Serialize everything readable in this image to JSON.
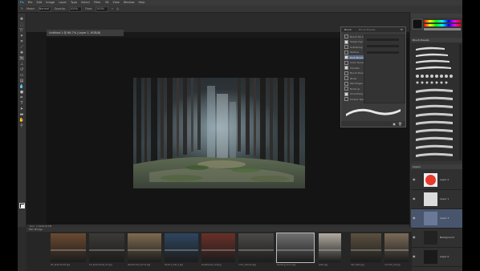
{
  "menubar": {
    "items": [
      "Ps",
      "File",
      "Edit",
      "Image",
      "Layer",
      "Type",
      "Select",
      "Filter",
      "3D",
      "View",
      "Window",
      "Help"
    ]
  },
  "optionsbar": {
    "mode_label": "Mode:",
    "mode_value": "Normal",
    "opacity_label": "Opacity:",
    "opacity_value": "100%",
    "flow_label": "Flow:",
    "flow_value": "100%"
  },
  "document": {
    "tab_title": "Untitled-1 @ 66.7% (Layer 1, RGB/8)",
    "status": "Doc: 7.91M/18.5M"
  },
  "brush_panel": {
    "tabs": [
      "Brush",
      "Brush Presets"
    ],
    "options": [
      {
        "label": "Brush Tip Shape",
        "checked": false,
        "selected": false
      },
      {
        "label": "Shape Dynamics",
        "checked": true,
        "selected": false
      },
      {
        "label": "Scattering",
        "checked": false,
        "selected": false
      },
      {
        "label": "Texture",
        "checked": false,
        "selected": false
      },
      {
        "label": "Dual Brush",
        "checked": true,
        "selected": true
      },
      {
        "label": "Color Dynamics",
        "checked": false,
        "selected": false
      },
      {
        "label": "Transfer",
        "checked": true,
        "selected": false
      },
      {
        "label": "Brush Pose",
        "checked": false,
        "selected": false
      },
      {
        "label": "Noise",
        "checked": false,
        "selected": false
      },
      {
        "label": "Wet Edges",
        "checked": false,
        "selected": false
      },
      {
        "label": "Build-up",
        "checked": false,
        "selected": false
      },
      {
        "label": "Smoothing",
        "checked": true,
        "selected": false
      },
      {
        "label": "Protect Texture",
        "checked": false,
        "selected": false
      }
    ]
  },
  "right_dock": {
    "swatches_title": "Color",
    "brush_presets_title": "Brush Presets",
    "layers_title": "Layers",
    "layers": [
      {
        "name": "Layer 2",
        "thumb_color": "#e83a2c",
        "selected": false
      },
      {
        "name": "Layer 1",
        "thumb_color": "#dcdcdc",
        "selected": false
      },
      {
        "name": "Layer 3",
        "thumb_color": "#6a7a96",
        "selected": true
      },
      {
        "name": "Background",
        "thumb_color": "#222222",
        "selected": false
      },
      {
        "name": "Layer 0",
        "thumb_color": "#1a1a1a",
        "selected": false
      }
    ]
  },
  "filmstrip": {
    "title": "Mini Bridge",
    "thumbs": [
      {
        "caption": "05_abandon01.jpg",
        "tone": "#6a4a30"
      },
      {
        "caption": "16_abandoned_07.jpg",
        "tone": "#3b3a36"
      },
      {
        "caption": "abandoned_arch1.jpg",
        "tone": "#7d6a50"
      },
      {
        "caption": "factory_hall_2.jpg",
        "tone": "#2e4660"
      },
      {
        "caption": "warehouse_red.jpg",
        "tone": "#6a3028"
      },
      {
        "caption": "ruins_interior.jpg",
        "tone": "#4b4a48"
      },
      {
        "caption": "building_2ruin.jpg",
        "tone": "#707070"
      },
      {
        "caption": "pillar.jpg",
        "tone": "#b0aaa0"
      },
      {
        "caption": "hall_dark.jpg",
        "tone": "#5a5040"
      },
      {
        "caption": "corridor_01.jpg",
        "tone": "#7a6a58"
      }
    ]
  },
  "colors": {
    "app_bg": "#2b2b2b",
    "canvas_bg": "#141414",
    "selection": "#48556d",
    "accent_red": "#e83a2c"
  }
}
